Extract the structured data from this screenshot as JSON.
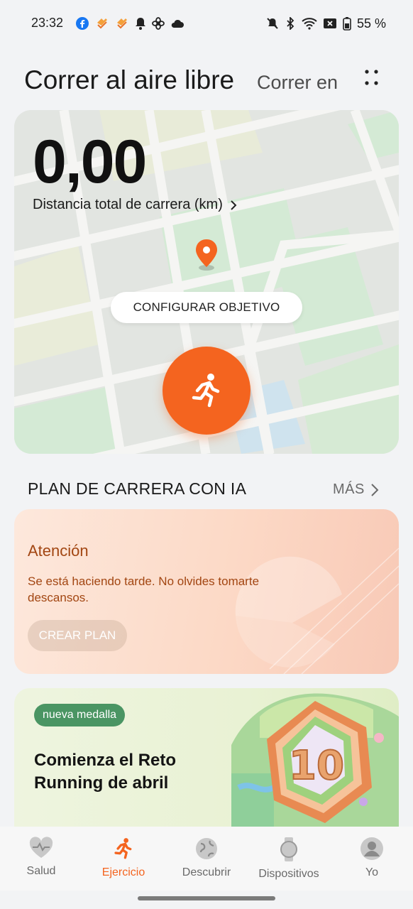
{
  "status_bar": {
    "time": "23:32",
    "battery": "55 %",
    "left_icons": [
      "facebook-icon",
      "heart-rate-app-icon",
      "heart-rate-app-icon",
      "bell-icon",
      "fan-icon",
      "cloud-icon"
    ],
    "right_icons": [
      "mute-icon",
      "bluetooth-icon",
      "wifi-icon",
      "sim-off-icon",
      "battery-icon"
    ]
  },
  "header": {
    "title": "Correr al aire libre",
    "secondary_tab": "Correr en",
    "more_icon": "more-dots-icon"
  },
  "map_card": {
    "distance_value": "0,00",
    "distance_label": "Distancia total de carrera (km)",
    "goal_button": "CONFIGURAR OBJETIVO",
    "start_icon": "running-person-icon",
    "accent_color": "#f4641f"
  },
  "ai_plan": {
    "section_title": "PLAN DE CARRERA CON IA",
    "more_label": "MÁS",
    "heading": "Atención",
    "message": "Se está haciendo tarde. No olvides tomarte descansos.",
    "create_button": "CREAR PLAN"
  },
  "banner": {
    "badge": "nueva medalla",
    "title": "Comienza el Reto Running de abril"
  },
  "bottom_nav": {
    "items": [
      {
        "label": "Salud",
        "icon": "heart-pulse-icon",
        "active": false
      },
      {
        "label": "Ejercicio",
        "icon": "running-person-icon",
        "active": true
      },
      {
        "label": "Descubrir",
        "icon": "globe-icon",
        "active": false
      },
      {
        "label": "Dispositivos",
        "icon": "watch-icon",
        "active": false
      },
      {
        "label": "Yo",
        "icon": "user-icon",
        "active": false
      }
    ]
  }
}
